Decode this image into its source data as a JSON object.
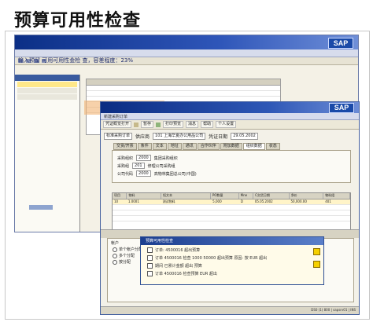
{
  "page": {
    "title": "预算可用性检查"
  },
  "back_window": {
    "brand": "SAP",
    "header_text": "输入预留 可用可用性金检 查，容差程度：23%"
  },
  "front_window": {
    "brand": "SAP",
    "title": "新建采购订单",
    "toolbar": {
      "doc_overview_label": "凭证概览打开",
      "hold_label": "暂存",
      "print_preview_label": "打印预览",
      "messages_label": "消息",
      "help_label": "帮助",
      "personal_settings_label": "个人设置"
    },
    "po_type": "标准采购订单",
    "vendor_label": "供应商",
    "vendor_value": "101 上海华夏办公用品公司",
    "doc_date_label": "凭证日期",
    "doc_date_value": "29.05.2002",
    "tabs": [
      "交货/开票",
      "条件",
      "文本",
      "地址",
      "通讯",
      "合作伙伴",
      "附加数据",
      "组织数据",
      "状态"
    ],
    "active_tab": "组织数据",
    "org": {
      "purchase_org_label": "采购组织",
      "purchase_org_code": "2000",
      "purchase_org_desc": "集团采购组织",
      "purchase_group_label": "采购组",
      "purchase_group_code": "201",
      "purchase_group_desc": "修理公司采购组",
      "company_code_label": "公司代码",
      "company_code_value": "2000",
      "company_code_desc": "高物林集团总公司(中国)"
    },
    "item_table": {
      "headers": [
        "项目",
        "物料",
        "短文本",
        "PO数量",
        "Mne",
        "C交货日期",
        "净价",
        "物料组"
      ],
      "rows": [
        {
          "item": "10",
          "material": "1.0001",
          "text": "测试物料",
          "qty": "5,000",
          "unit": "D",
          "date": "05.05.2002",
          "price": "50,000.00",
          "group": "401"
        }
      ]
    },
    "account_label": "帐户",
    "options": [
      "单个帐户分配",
      "多个分配",
      "按分配"
    ],
    "status_text": "DS0 (1) 800 | sapsrv01 | INS"
  },
  "popup": {
    "title": "预算可用性检查",
    "messages": [
      "订单: 4500016 超出预算",
      "订单 4500016 检查 1000 50000 超出预算 原因: 按 EUR 超出",
      "期间 已累计金额 超出 预算",
      "订单 4500016 检查预算 EUR 超出"
    ]
  }
}
